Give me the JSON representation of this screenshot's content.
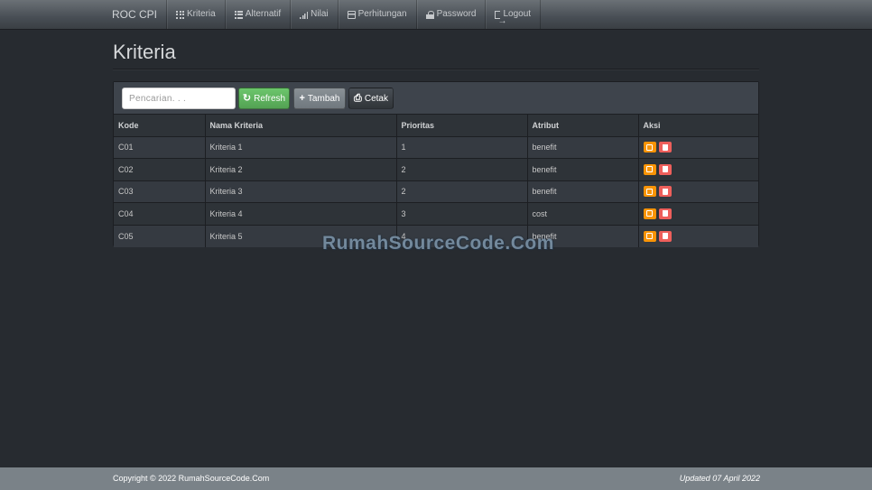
{
  "navbar": {
    "brand": "ROC CPI",
    "items": [
      {
        "label": "Kriteria",
        "icon": "grid-icon"
      },
      {
        "label": "Alternatif",
        "icon": "list-icon"
      },
      {
        "label": "Nilai",
        "icon": "signal-icon"
      },
      {
        "label": "Perhitungan",
        "icon": "calculator-icon"
      },
      {
        "label": "Password",
        "icon": "lock-icon"
      },
      {
        "label": "Logout",
        "icon": "logout-icon"
      }
    ]
  },
  "page": {
    "title": "Kriteria"
  },
  "toolbar": {
    "search_placeholder": "Pencarian. . .",
    "search_value": "",
    "refresh_label": "Refresh",
    "tambah_label": "Tambah",
    "cetak_label": "Cetak"
  },
  "table": {
    "headers": [
      "Kode",
      "Nama Kriteria",
      "Prioritas",
      "Atribut",
      "Aksi"
    ],
    "rows": [
      {
        "kode": "C01",
        "nama": "Kriteria 1",
        "prioritas": "1",
        "atribut": "benefit"
      },
      {
        "kode": "C02",
        "nama": "Kriteria 2",
        "prioritas": "2",
        "atribut": "benefit"
      },
      {
        "kode": "C03",
        "nama": "Kriteria 3",
        "prioritas": "2",
        "atribut": "benefit"
      },
      {
        "kode": "C04",
        "nama": "Kriteria 4",
        "prioritas": "3",
        "atribut": "cost"
      },
      {
        "kode": "C05",
        "nama": "Kriteria 5",
        "prioritas": "4",
        "atribut": "benefit"
      }
    ]
  },
  "watermark": "RumahSourceCode.Com",
  "footer": {
    "copyright": "Copyright © 2022 RumahSourceCode.Com",
    "updated": "Updated 07 April 2022"
  },
  "colors": {
    "background": "#272b30",
    "success": "#62c462",
    "warning": "#f89406",
    "danger": "#ee5f5b",
    "footer": "#7a8288"
  }
}
